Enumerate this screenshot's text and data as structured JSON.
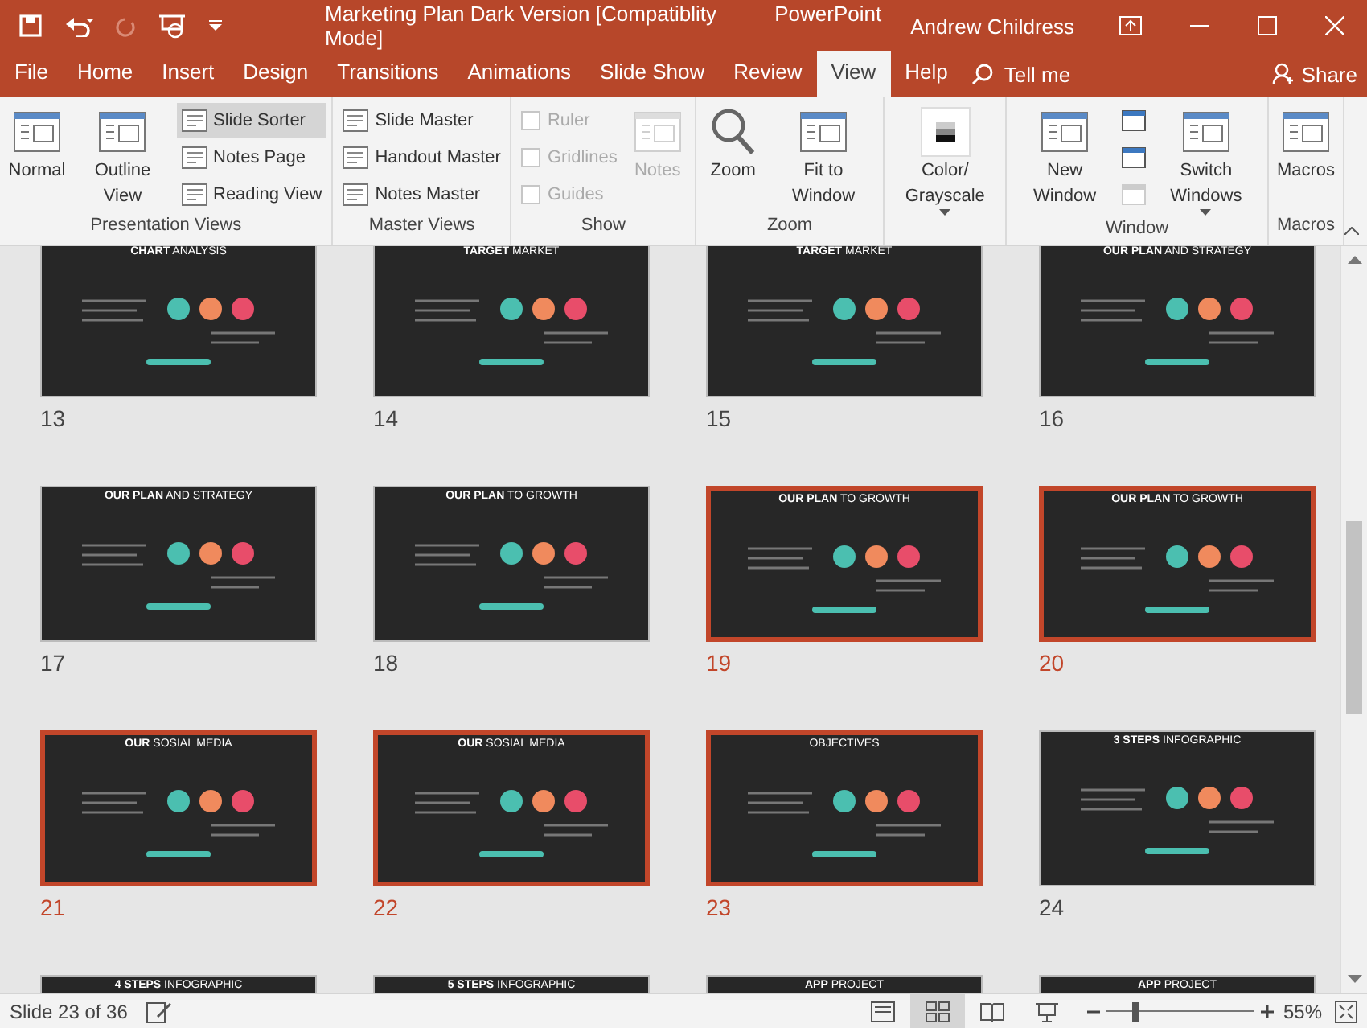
{
  "window": {
    "title": "Marketing Plan Dark Version [Compatiblity Mode]",
    "app_name": "PowerPoint",
    "user": "Andrew Childress"
  },
  "tabs": [
    {
      "label": "File",
      "selected": false
    },
    {
      "label": "Home",
      "selected": false
    },
    {
      "label": "Insert",
      "selected": false
    },
    {
      "label": "Design",
      "selected": false
    },
    {
      "label": "Transitions",
      "selected": false
    },
    {
      "label": "Animations",
      "selected": false
    },
    {
      "label": "Slide Show",
      "selected": false
    },
    {
      "label": "Review",
      "selected": false
    },
    {
      "label": "View",
      "selected": true
    },
    {
      "label": "Help",
      "selected": false
    }
  ],
  "tell_me": "Tell me",
  "share": "Share",
  "ribbon": [
    {
      "label": "Presentation Views",
      "items": [
        {
          "kind": "large",
          "label": "Normal",
          "selected": false
        },
        {
          "kind": "large",
          "label": "Outline View",
          "selected": false
        },
        {
          "kind": "small",
          "label": "Slide Sorter",
          "selected": true
        },
        {
          "kind": "small",
          "label": "Notes Page",
          "selected": false
        },
        {
          "kind": "small",
          "label": "Reading View",
          "selected": false
        }
      ]
    },
    {
      "label": "Master Views",
      "items": [
        {
          "kind": "small",
          "label": "Slide Master"
        },
        {
          "kind": "small",
          "label": "Handout Master"
        },
        {
          "kind": "small",
          "label": "Notes Master"
        }
      ]
    },
    {
      "label": "Show",
      "items": [
        {
          "kind": "check",
          "label": "Ruler",
          "checked": false,
          "disabled": true
        },
        {
          "kind": "check",
          "label": "Gridlines",
          "checked": false,
          "disabled": true
        },
        {
          "kind": "check",
          "label": "Guides",
          "checked": false,
          "disabled": true
        },
        {
          "kind": "large",
          "label": "Notes",
          "disabled": true
        }
      ]
    },
    {
      "label": "Zoom",
      "items": [
        {
          "kind": "large",
          "label": "Zoom"
        },
        {
          "kind": "large",
          "label": "Fit to Window"
        }
      ]
    },
    {
      "items": [
        {
          "kind": "large",
          "label": "Color/ Grayscale",
          "dropdown": true
        }
      ]
    },
    {
      "label": "Window",
      "items": [
        {
          "kind": "large",
          "label": "New Window"
        },
        {
          "kind": "icon",
          "disabled": false
        },
        {
          "kind": "icon",
          "disabled": false
        },
        {
          "kind": "icon",
          "disabled": true
        },
        {
          "kind": "large",
          "label": "Switch Windows",
          "dropdown": true
        }
      ]
    },
    {
      "label": "Macros",
      "items": [
        {
          "kind": "large",
          "label": "Macros"
        }
      ]
    }
  ],
  "slides": [
    {
      "number": "13",
      "title": "**CHART** ANALYSIS",
      "selected": false
    },
    {
      "number": "14",
      "title": "**TARGET** MARKET",
      "selected": false
    },
    {
      "number": "15",
      "title": "**TARGET** MARKET",
      "selected": false
    },
    {
      "number": "16",
      "title": "**OUR PLAN** AND STRATEGY",
      "selected": false
    },
    {
      "number": "17",
      "title": "**OUR PLAN** AND STRATEGY",
      "selected": false
    },
    {
      "number": "18",
      "title": "**OUR PLAN** TO GROWTH",
      "selected": false
    },
    {
      "number": "19",
      "title": "**OUR PLAN** TO GROWTH",
      "selected": true
    },
    {
      "number": "20",
      "title": "**OUR PLAN** TO GROWTH",
      "selected": true
    },
    {
      "number": "21",
      "title": "**OUR** SOSIAL MEDIA",
      "selected": true
    },
    {
      "number": "22",
      "title": "**OUR** SOSIAL MEDIA",
      "selected": true
    },
    {
      "number": "23",
      "title": "OBJECTIVES",
      "selected": true
    },
    {
      "number": "24",
      "title": "**3 STEPS** INFOGRAPHIC",
      "selected": false
    },
    {
      "title": "**4 STEPS** INFOGRAPHIC",
      "selected": false
    },
    {
      "title": "**5 STEPS** INFOGRAPHIC",
      "selected": false
    },
    {
      "title": "**APP** PROJECT",
      "selected": false
    },
    {
      "title": "**APP** PROJECT",
      "selected": false
    }
  ],
  "status_bar": {
    "slide_info": "Slide 23 of 36",
    "views": [
      {
        "selected": false
      },
      {
        "selected": true
      },
      {
        "selected": false
      },
      {
        "selected": false
      }
    ],
    "zoom": {
      "level": 0.2,
      "reading": "55%"
    }
  }
}
